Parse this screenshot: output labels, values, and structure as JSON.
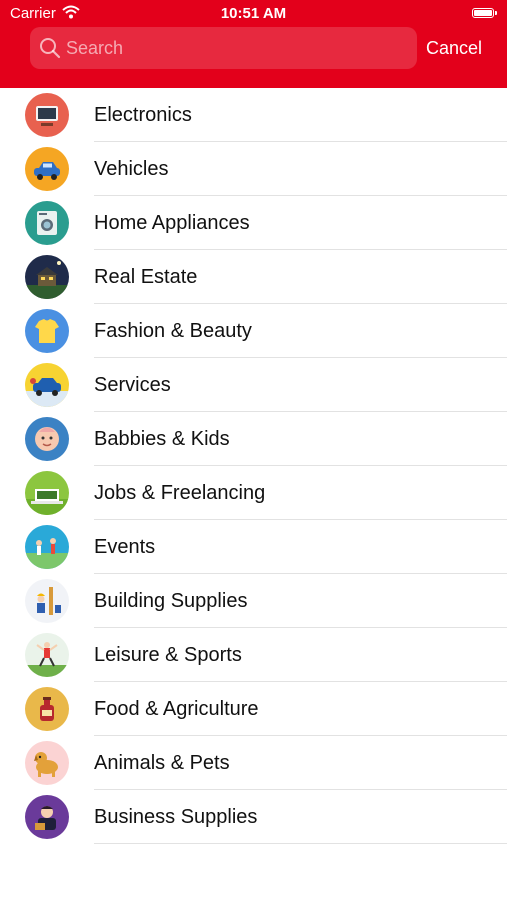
{
  "status_bar": {
    "carrier": "Carrier",
    "time": "10:51 AM"
  },
  "search": {
    "placeholder": "Search",
    "value": ""
  },
  "cancel_label": "Cancel",
  "categories": [
    {
      "label": "Electronics",
      "icon": "tv-icon",
      "color": "#e8614f"
    },
    {
      "label": "Vehicles",
      "icon": "car-icon",
      "color": "#f5a623"
    },
    {
      "label": "Home Appliances",
      "icon": "washing-machine-icon",
      "color": "#2a9d8f"
    },
    {
      "label": "Real Estate",
      "icon": "house-icon",
      "color": "#1f2b4a"
    },
    {
      "label": "Fashion & Beauty",
      "icon": "tshirt-icon",
      "color": "#4a90e2"
    },
    {
      "label": "Services",
      "icon": "car-wash-icon",
      "color": "#f7d332"
    },
    {
      "label": "Babbies & Kids",
      "icon": "baby-icon",
      "color": "#3b82c4"
    },
    {
      "label": "Jobs & Freelancing",
      "icon": "workspace-icon",
      "color": "#8cc63f"
    },
    {
      "label": "Events",
      "icon": "people-icon",
      "color": "#2aa9d8"
    },
    {
      "label": "Building Supplies",
      "icon": "builder-icon",
      "color": "#f1f3f7"
    },
    {
      "label": "Leisure & Sports",
      "icon": "athlete-icon",
      "color": "#eaf3ea"
    },
    {
      "label": "Food & Agriculture",
      "icon": "food-icon",
      "color": "#e9b84a"
    },
    {
      "label": "Animals & Pets",
      "icon": "dog-icon",
      "color": "#fbd3d3"
    },
    {
      "label": "Business Supplies",
      "icon": "business-icon",
      "color": "#6a3a9a"
    }
  ]
}
